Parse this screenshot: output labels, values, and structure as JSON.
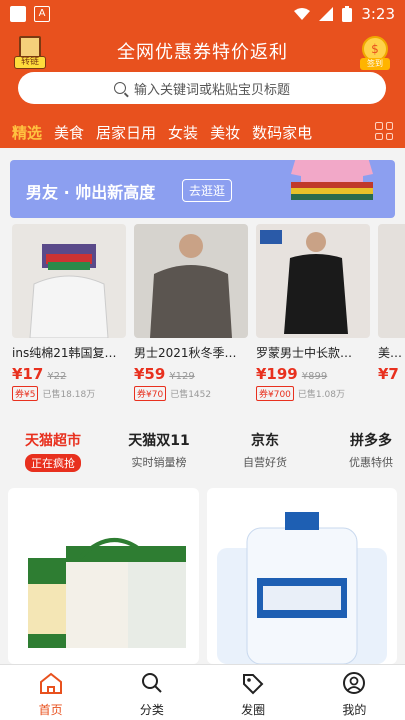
{
  "status_bar": {
    "time": "3:23",
    "a_label": "A"
  },
  "header": {
    "title": "全网优惠券特价返利",
    "left_badge": "转链",
    "right_badge": "签到",
    "right_coin": "$",
    "search_placeholder": "输入关键词或粘贴宝贝标题"
  },
  "categories": [
    "精选",
    "美食",
    "居家日用",
    "女装",
    "美妆",
    "数码家电"
  ],
  "banner": {
    "text": "男友 · 帅出新高度",
    "button": "去逛逛"
  },
  "products": [
    {
      "name": "ins纯棉21韩国复…",
      "price": "¥17",
      "old": "¥22",
      "coupon": "券¥5",
      "sold": "已售18.18万"
    },
    {
      "name": "男士2021秋冬季…",
      "price": "¥59",
      "old": "¥129",
      "coupon": "券¥70",
      "sold": "已售1452"
    },
    {
      "name": "罗蒙男士中长款…",
      "price": "¥199",
      "old": "¥899",
      "coupon": "券¥700",
      "sold": "已售1.08万"
    },
    {
      "name": "美…",
      "price": "¥7",
      "old": "",
      "coupon": "",
      "sold": ""
    }
  ],
  "tabs": [
    {
      "title": "天猫超市",
      "sub": "正在疯抢"
    },
    {
      "title": "天猫双11",
      "sub": "实时销量榜"
    },
    {
      "title": "京东",
      "sub": "自营好货"
    },
    {
      "title": "拼多多",
      "sub": "优惠特供"
    }
  ],
  "bottom_nav": [
    "首页",
    "分类",
    "发圈",
    "我的"
  ],
  "colors": {
    "brand": "#e8511e",
    "price": "#e8301e"
  }
}
